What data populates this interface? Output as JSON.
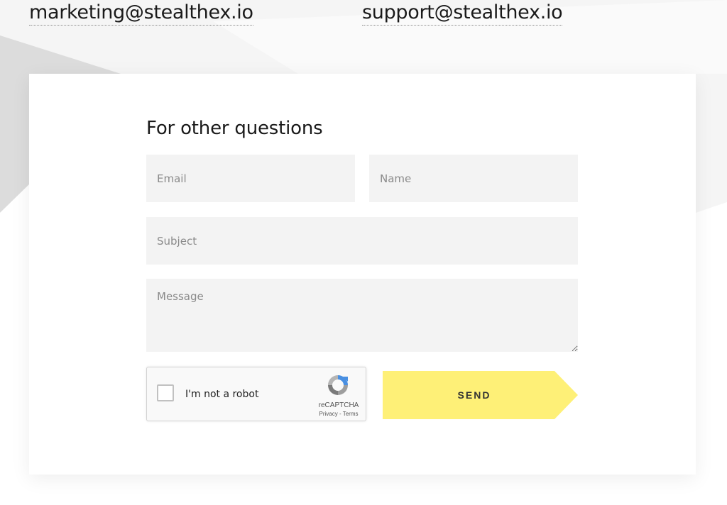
{
  "contacts": {
    "marketing_email": "marketing@stealthex.io",
    "support_email": "support@stealthex.io"
  },
  "form": {
    "title": "For other questions",
    "email_placeholder": "Email",
    "name_placeholder": "Name",
    "subject_placeholder": "Subject",
    "message_placeholder": "Message",
    "send_label": "SEND"
  },
  "recaptcha": {
    "checkbox_label": "I'm not a robot",
    "brand": "reCAPTCHA",
    "links": "Privacy - Terms",
    "logo_icon": "recaptcha-logo-icon"
  },
  "colors": {
    "send_button": "#fef077",
    "field_background": "#f3f3f3",
    "background_shape": "#dcdcdc"
  }
}
